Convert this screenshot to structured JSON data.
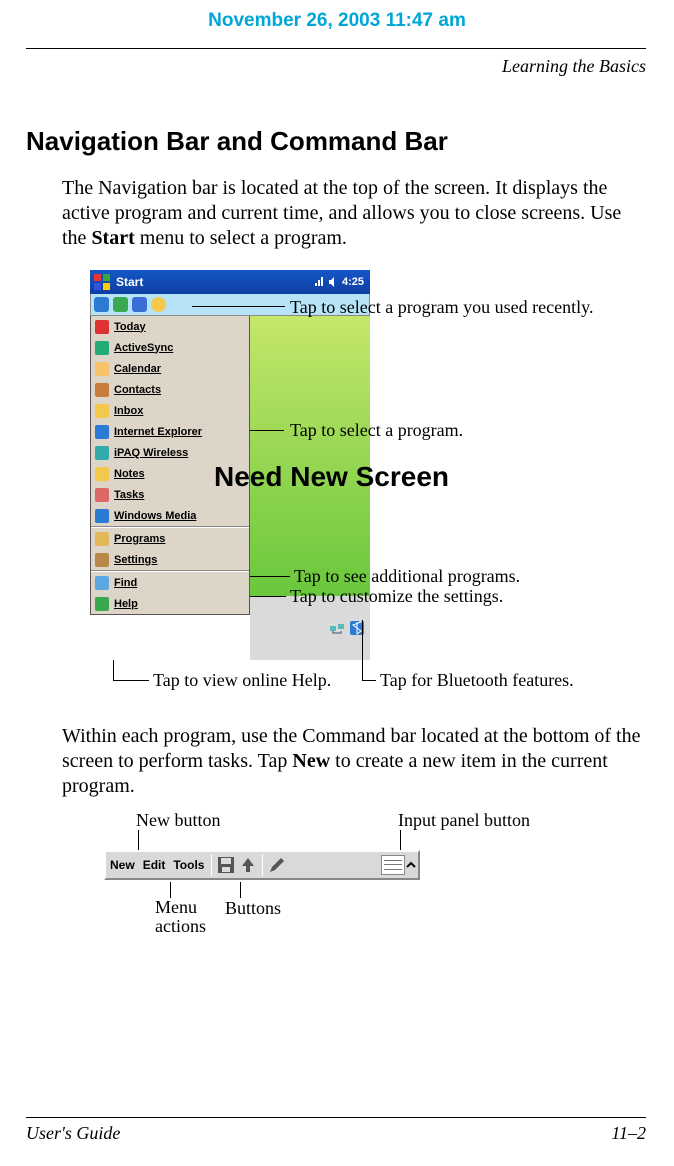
{
  "header": {
    "timestamp": "November 26, 2003 11:47 am",
    "section": "Learning the Basics"
  },
  "title": "Navigation Bar and Command Bar",
  "para1_a": "The Navigation bar is located at the top of the screen. It displays the active program and current time, and allows you to close screens. Use the ",
  "para1_bold": "Start",
  "para1_b": " menu to select a program.",
  "startmenu": {
    "start": "Start",
    "time": "4:25",
    "items_top": [
      {
        "label": "Today",
        "color": "#d33"
      },
      {
        "label": "ActiveSync",
        "color": "#2a7"
      },
      {
        "label": "Calendar",
        "color": "#f6c36a"
      },
      {
        "label": "Contacts",
        "color": "#c77d3a"
      },
      {
        "label": "Inbox",
        "color": "#f2c94c"
      },
      {
        "label": "Internet Explorer",
        "color": "#2b7bd4"
      },
      {
        "label": "iPAQ Wireless",
        "color": "#3aa"
      },
      {
        "label": "Notes",
        "color": "#f2c94c"
      },
      {
        "label": "Tasks",
        "color": "#d66"
      },
      {
        "label": "Windows Media",
        "color": "#2b7bd4"
      }
    ],
    "items_mid": [
      {
        "label": "Programs",
        "color": "#e2b95a"
      },
      {
        "label": "Settings",
        "color": "#b88a4a"
      }
    ],
    "items_bot": [
      {
        "label": "Find",
        "color": "#5aa7e2"
      },
      {
        "label": "Help",
        "color": "#3aa84f"
      }
    ]
  },
  "callouts": {
    "recent": "Tap to select a program you used recently.",
    "program": "Tap to select a program.",
    "more": "Tap to see additional programs.",
    "settings": "Tap to customize the settings.",
    "help": "Tap to view online Help.",
    "bt": "Tap for Bluetooth features."
  },
  "overlay": "Need New Screen",
  "para2_a": "Within each program, use the Command bar located at the bottom of the screen to perform tasks. Tap ",
  "para2_bold": "New",
  "para2_b": " to create a new item in the current program.",
  "cmdbar": {
    "new": "New",
    "edit": "Edit",
    "tools": "Tools",
    "labels": {
      "newbtn": "New button",
      "input": "Input panel button",
      "menu_a": "Menu",
      "menu_b": "actions",
      "buttons": "Buttons"
    }
  },
  "footer": {
    "left": "User's Guide",
    "right": "11–2"
  }
}
